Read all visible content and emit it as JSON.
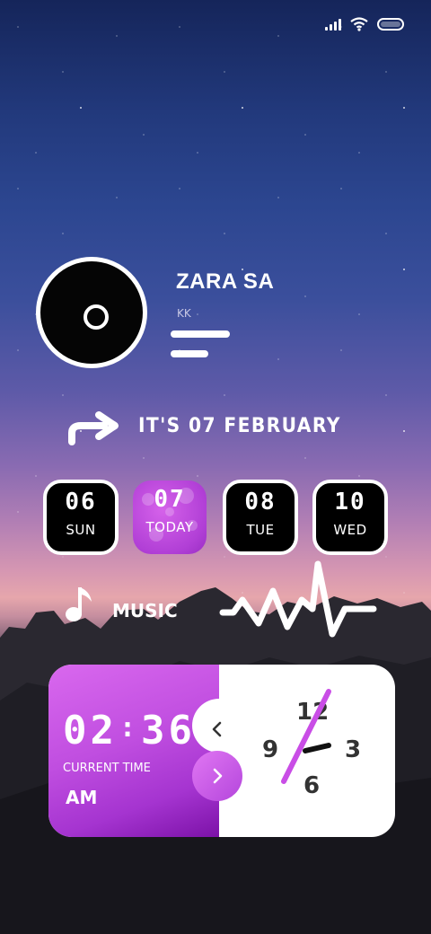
{
  "status_bar": {
    "signal_icon": "signal-bars-icon",
    "wifi_icon": "wifi-icon",
    "battery_icon": "battery-icon"
  },
  "music_player": {
    "title": "ZARA SA",
    "artist": "KK",
    "disc_icon": "vinyl-disc-icon"
  },
  "date_banner": {
    "text": "IT'S 07 FEBRUARY",
    "icon": "arrow-turn-right-icon"
  },
  "days": [
    {
      "num": "06",
      "label": "SUN"
    },
    {
      "num": "07",
      "label": "TODAY"
    },
    {
      "num": "08",
      "label": "TUE"
    },
    {
      "num": "10",
      "label": "WED"
    }
  ],
  "music_row": {
    "label": "MUSIC",
    "icon": "music-note-icon",
    "wave_icon": "pulse-wave-icon"
  },
  "clock_card": {
    "time_hours": "02",
    "time_separator": ":",
    "time_minutes": "36",
    "current_time_label": "CURRENT TIME",
    "ampm": "AM",
    "analog_numbers": {
      "twelve": "12",
      "three": "3",
      "six": "6",
      "nine": "9"
    },
    "back_icon": "chevron-left-icon",
    "next_icon": "chevron-right-icon"
  },
  "colors": {
    "accent": "#c04ee0",
    "accent_dark": "#7c12a8",
    "card_bg": "#ffffff",
    "dark_tile": "#000000"
  }
}
